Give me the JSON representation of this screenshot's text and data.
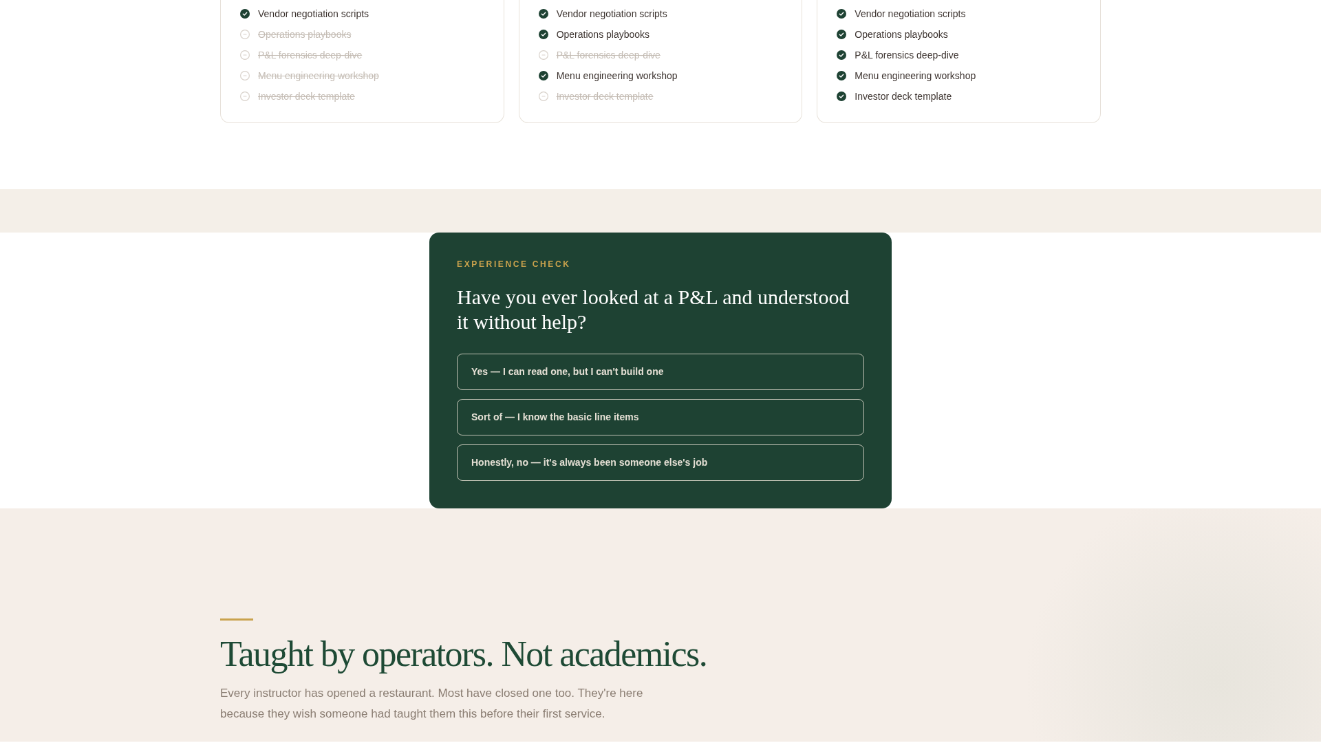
{
  "plans": [
    {
      "features": [
        {
          "label": "Vendor negotiation scripts",
          "included": true
        },
        {
          "label": "Operations playbooks",
          "included": false
        },
        {
          "label": "P&L forensics deep-dive",
          "included": false
        },
        {
          "label": "Menu engineering workshop",
          "included": false
        },
        {
          "label": "Investor deck template",
          "included": false
        }
      ]
    },
    {
      "features": [
        {
          "label": "Vendor negotiation scripts",
          "included": true
        },
        {
          "label": "Operations playbooks",
          "included": true
        },
        {
          "label": "P&L forensics deep-dive",
          "included": false
        },
        {
          "label": "Menu engineering workshop",
          "included": true
        },
        {
          "label": "Investor deck template",
          "included": false
        }
      ]
    },
    {
      "features": [
        {
          "label": "Vendor negotiation scripts",
          "included": true
        },
        {
          "label": "Operations playbooks",
          "included": true
        },
        {
          "label": "P&L forensics deep-dive",
          "included": true
        },
        {
          "label": "Menu engineering workshop",
          "included": true
        },
        {
          "label": "Investor deck template",
          "included": true
        }
      ]
    }
  ],
  "experience_check": {
    "eyebrow": "EXPERIENCE CHECK",
    "question": "Have you ever looked at a P&L and understood it without help?",
    "options": [
      {
        "label": "Yes — I can read one, but I can't build one",
        "selected": false
      },
      {
        "label": "Sort of — I know the basic line items",
        "selected": false
      },
      {
        "label": "Honestly, no — it's always been someone else's job",
        "selected": false
      }
    ]
  },
  "instructors": {
    "heading": "Taught by operators. Not academics.",
    "description": "Every instructor has opened a restaurant. Most have closed one too. They're here because they wish someone had taught them this before their first service."
  }
}
